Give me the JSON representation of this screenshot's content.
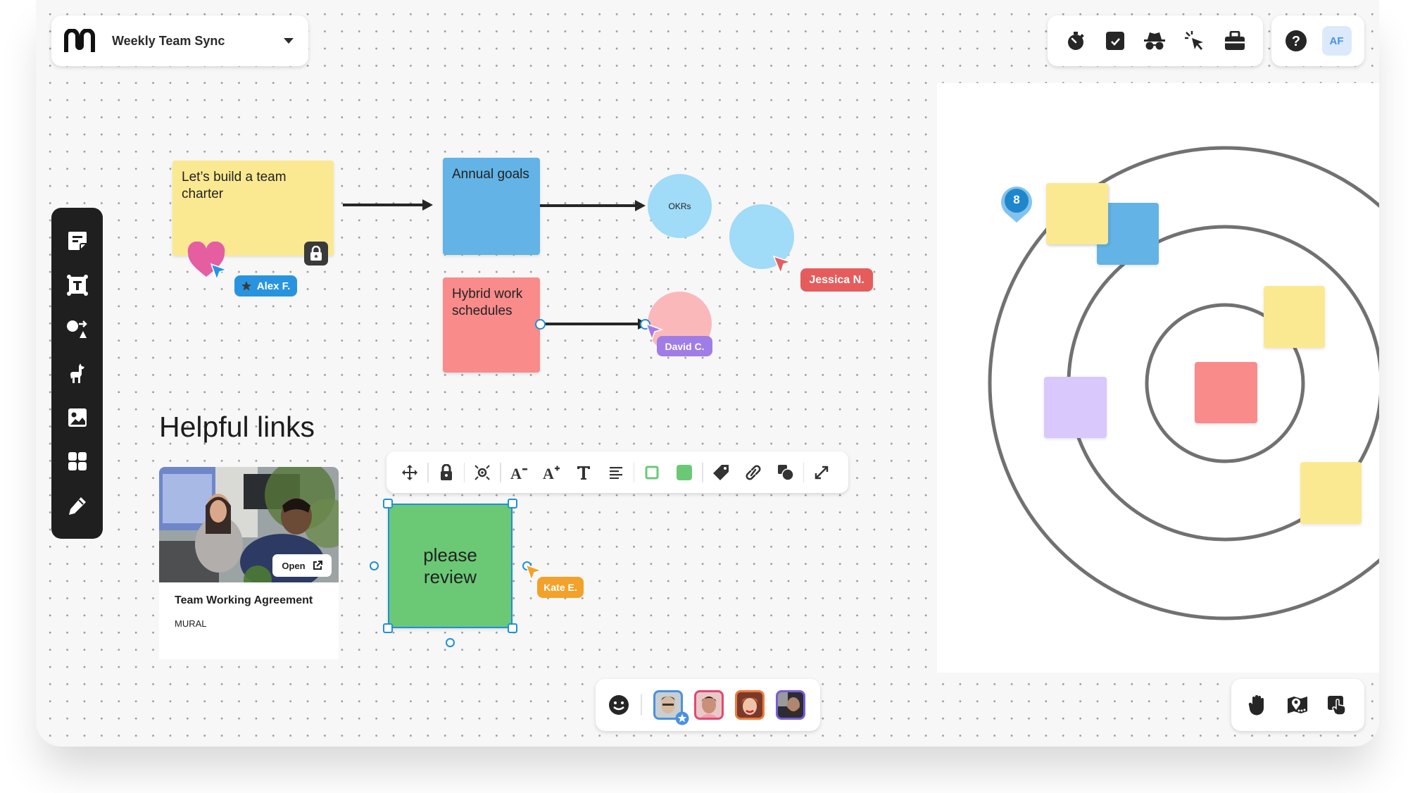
{
  "header": {
    "logo": "mural-logo-icon",
    "board_title": "Weekly Team Sync",
    "dropdown_icon": "caret-down-icon"
  },
  "top_toolbar": {
    "tools": [
      {
        "name": "timer",
        "icon": "stopwatch-icon"
      },
      {
        "name": "voting",
        "icon": "checkbox-icon"
      },
      {
        "name": "private-mode",
        "icon": "incognito-icon"
      },
      {
        "name": "summon",
        "icon": "cursor-click-icon"
      },
      {
        "name": "toolkit",
        "icon": "toolbox-icon"
      }
    ],
    "help_icon": "question-circle-icon",
    "user_initials": "AF"
  },
  "left_toolbar": {
    "items": [
      {
        "name": "sticky-note",
        "icon": "sticky-note-icon"
      },
      {
        "name": "text",
        "icon": "text-box-icon"
      },
      {
        "name": "shapes-connectors",
        "icon": "shapes-icon"
      },
      {
        "name": "icons",
        "icon": "llama-icon"
      },
      {
        "name": "images",
        "icon": "image-icon"
      },
      {
        "name": "templates",
        "icon": "grid-icon"
      },
      {
        "name": "draw",
        "icon": "pencil-icon"
      }
    ]
  },
  "canvas": {
    "notes": [
      {
        "id": "team-charter",
        "text": "Let’s build a team charter",
        "color": "#fbe992",
        "locked": true
      },
      {
        "id": "annual-goals",
        "text": "Annual goals",
        "color": "#63b3e6"
      },
      {
        "id": "hybrid-work",
        "text": "Hybrid work schedules",
        "color": "#f98b8b"
      }
    ],
    "circles": [
      {
        "id": "okrs",
        "text": "OKRs",
        "color": "#a0dbf7"
      },
      {
        "id": "blank-blue",
        "text": "",
        "color": "#a0dbf7"
      },
      {
        "id": "blank-pink",
        "text": "",
        "color": "#fbb8bb"
      }
    ],
    "collaborators": [
      {
        "name": "Alex F.",
        "color": "#2894e0",
        "facilitator": true
      },
      {
        "name": "Jessica N.",
        "color": "#e65c5c"
      },
      {
        "name": "David C.",
        "color": "#a07de6"
      },
      {
        "name": "Kate E.",
        "color": "#f2a22a"
      }
    ],
    "reaction": "heart-icon",
    "section_heading": "Helpful links",
    "link_card": {
      "title": "Team Working Agreement",
      "source": "MURAL",
      "open_label": "Open"
    },
    "selected_note": {
      "text": "please review",
      "color": "#6bc976"
    }
  },
  "selection_toolbar": {
    "tools": [
      "move-icon",
      "lock-icon",
      "focus-icon",
      "decrease-font-icon",
      "increase-font-icon",
      "text-format-icon",
      "align-icon",
      "border-color-icon",
      "fill-color-icon",
      "tag-icon",
      "link-icon",
      "shapes-icon",
      "expand-icon"
    ],
    "fill_color": "#6bc976"
  },
  "target_panel": {
    "pin_count": "8",
    "notes": [
      {
        "color": "#fbe992"
      },
      {
        "color": "#63b3e6"
      },
      {
        "color": "#fbe992"
      },
      {
        "color": "#d9c8fb"
      },
      {
        "color": "#f98b8b"
      },
      {
        "color": "#fbe992"
      }
    ]
  },
  "bottom_bar": {
    "reaction_icon": "smiley-icon",
    "participants": [
      {
        "border": "#4a90e2",
        "facilitator": true
      },
      {
        "border": "#e04a72"
      },
      {
        "border": "#ef7a3c"
      },
      {
        "border": "#7b5cd6"
      }
    ]
  },
  "bottom_right": {
    "tools": [
      "hand-raise-icon",
      "outline-map-icon",
      "touch-mode-icon"
    ]
  }
}
